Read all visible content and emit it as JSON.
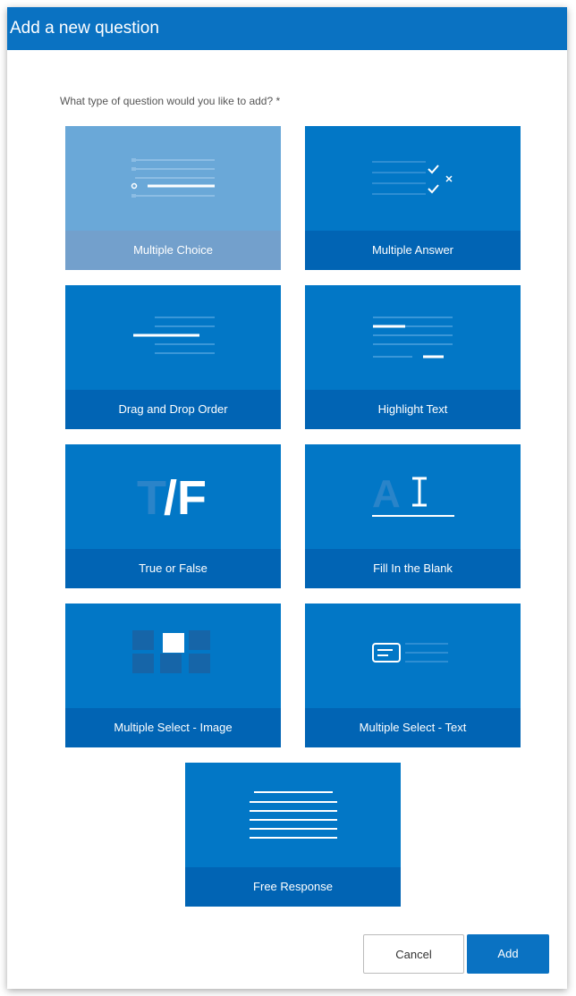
{
  "dialog": {
    "title": "Add a new question",
    "prompt": "What type of question would you like to add? *"
  },
  "question_types": [
    {
      "label": "Multiple Choice",
      "icon": "multiple-choice-icon",
      "selected": true
    },
    {
      "label": "Multiple Answer",
      "icon": "multiple-answer-icon"
    },
    {
      "label": "Drag and Drop Order",
      "icon": "drag-drop-order-icon"
    },
    {
      "label": "Highlight Text",
      "icon": "highlight-text-icon"
    },
    {
      "label": "True or False",
      "icon": "true-false-icon",
      "icon_text": "T/F"
    },
    {
      "label": "Fill In the Blank",
      "icon": "fill-blank-icon",
      "icon_text": "AI"
    },
    {
      "label": "Multiple Select - Image",
      "icon": "multiple-select-image-icon"
    },
    {
      "label": "Multiple Select - Text",
      "icon": "multiple-select-text-icon"
    },
    {
      "label": "Free Response",
      "icon": "free-response-icon"
    }
  ],
  "buttons": {
    "cancel": "Cancel",
    "add": "Add"
  },
  "colors": {
    "primary": "#0a72c2",
    "card": "#0277c6",
    "card_label": "#0164b4",
    "selected": "#6aa8d8"
  }
}
